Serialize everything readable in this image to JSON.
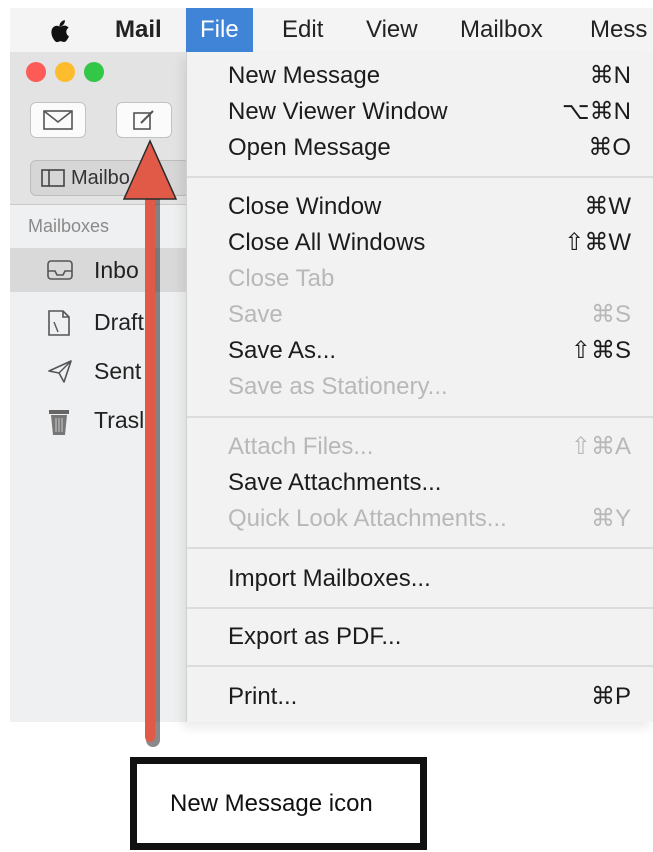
{
  "menubar": {
    "app_name": "Mail",
    "items": [
      "File",
      "Edit",
      "View",
      "Mailbox",
      "Mess"
    ]
  },
  "window": {
    "toolbar_buttons": [
      "envelope-icon",
      "compose-icon"
    ],
    "mailboxes_button": "Mailbo",
    "sidebar_heading": "Mailboxes",
    "sidebar_items": [
      {
        "label": "Inbo",
        "icon": "inbox-icon"
      },
      {
        "label": "Draft",
        "icon": "drafts-icon"
      },
      {
        "label": "Sent",
        "icon": "sent-icon"
      },
      {
        "label": "Trasl",
        "icon": "trash-icon"
      }
    ]
  },
  "file_menu": {
    "items": [
      {
        "label": "New Message",
        "shortcut": "⌘N",
        "enabled": true
      },
      {
        "label": "New Viewer Window",
        "shortcut": "⌥⌘N",
        "enabled": true
      },
      {
        "label": "Open Message",
        "shortcut": "⌘O",
        "enabled": true
      },
      {
        "label": "Close Window",
        "shortcut": "⌘W",
        "enabled": true
      },
      {
        "label": "Close All Windows",
        "shortcut": "⇧⌘W",
        "enabled": true
      },
      {
        "label": "Close Tab",
        "shortcut": "",
        "enabled": false
      },
      {
        "label": "Save",
        "shortcut": "⌘S",
        "enabled": false
      },
      {
        "label": "Save As...",
        "shortcut": "⇧⌘S",
        "enabled": true
      },
      {
        "label": "Save as Stationery...",
        "shortcut": "",
        "enabled": false
      },
      {
        "label": "Attach Files...",
        "shortcut": "⇧⌘A",
        "enabled": false
      },
      {
        "label": "Save Attachments...",
        "shortcut": "",
        "enabled": true
      },
      {
        "label": "Quick Look Attachments...",
        "shortcut": "⌘Y",
        "enabled": false
      },
      {
        "label": "Import Mailboxes...",
        "shortcut": "",
        "enabled": true
      },
      {
        "label": "Export as PDF...",
        "shortcut": "",
        "enabled": true
      },
      {
        "label": "Print...",
        "shortcut": "⌘P",
        "enabled": true
      }
    ]
  },
  "annotation": {
    "callout_text": "New Message icon",
    "arrow_color": "#e05a47"
  },
  "colors": {
    "menu_highlight": "#3f84d6"
  }
}
